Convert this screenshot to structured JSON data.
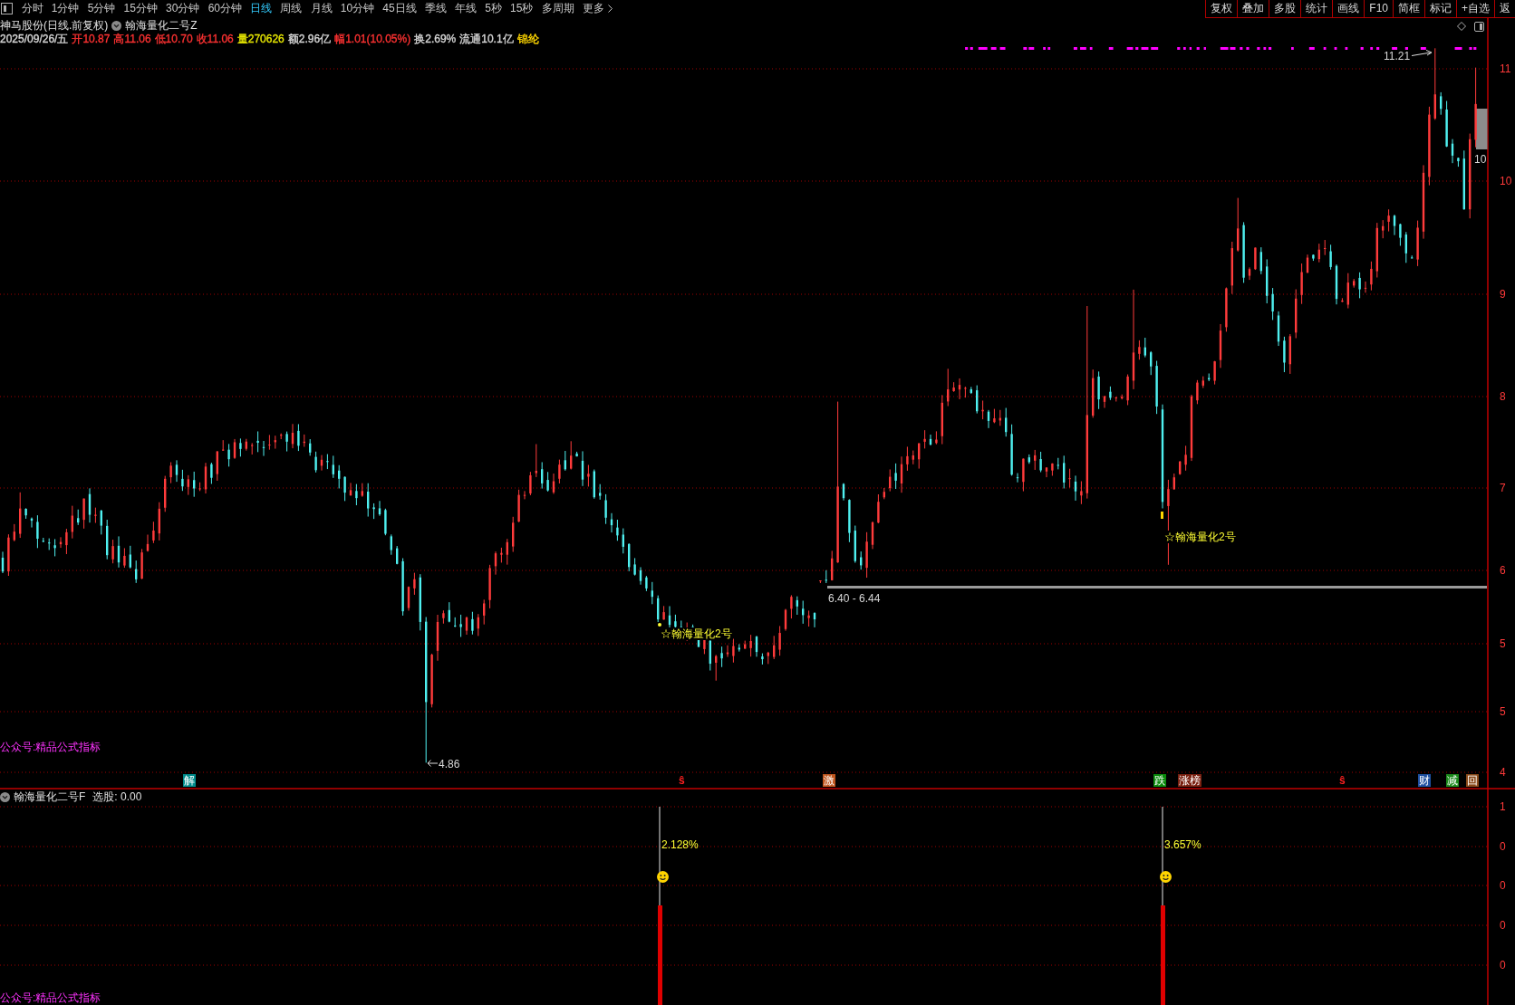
{
  "toolbar": {
    "periods": [
      {
        "label": "分时",
        "selected": false
      },
      {
        "label": "1分钟",
        "selected": false
      },
      {
        "label": "5分钟",
        "selected": false
      },
      {
        "label": "15分钟",
        "selected": false
      },
      {
        "label": "30分钟",
        "selected": false
      },
      {
        "label": "60分钟",
        "selected": false
      },
      {
        "label": "日线",
        "selected": true
      },
      {
        "label": "周线",
        "selected": false
      },
      {
        "label": "月线",
        "selected": false
      },
      {
        "label": "10分钟",
        "selected": false
      },
      {
        "label": "45日线",
        "selected": false
      },
      {
        "label": "季线",
        "selected": false
      },
      {
        "label": "年线",
        "selected": false
      },
      {
        "label": "5秒",
        "selected": false
      },
      {
        "label": "15秒",
        "selected": false
      },
      {
        "label": "多周期",
        "selected": false
      }
    ],
    "more": "更多",
    "buttons": [
      "复权",
      "叠加",
      "多股",
      "统计",
      "画线",
      "F10",
      "简框",
      "标记",
      "+自选",
      "返"
    ]
  },
  "title_row": {
    "security": "神马股份(日线.前复权)",
    "indicator": "翰海量化二号Z"
  },
  "quote_row": [
    {
      "text": "2025/09/26/五",
      "color": "#d8d8d8"
    },
    {
      "text": "开10.87",
      "color": "#ff3232"
    },
    {
      "text": "高11.06",
      "color": "#ff3232"
    },
    {
      "text": "低10.70",
      "color": "#ff3232"
    },
    {
      "text": "收11.06",
      "color": "#ff3232"
    },
    {
      "text": "量270626",
      "color": "#e6e600"
    },
    {
      "text": "额2.96亿",
      "color": "#d8d8d8"
    },
    {
      "text": "幅1.01(10.05%)",
      "color": "#ff3232"
    },
    {
      "text": "换2.69%",
      "color": "#d8d8d8"
    },
    {
      "text": "流通10.1亿",
      "color": "#d8d8d8"
    },
    {
      "text": "锦纶",
      "color": "#ffd700"
    }
  ],
  "main_chart": {
    "price_axis": [
      "11",
      "10",
      "9",
      "8",
      "7",
      "6",
      "5",
      "5",
      "4"
    ],
    "high_label": "11.21",
    "low_label": "4.86",
    "last_price_label": "10",
    "range_label": "6.40 - 6.44",
    "signals": [
      {
        "label": "☆翰海量化2号"
      },
      {
        "label": "☆翰海量化2号"
      }
    ],
    "note": "公众号:精品公式指标",
    "markers": [
      {
        "text": "解",
        "kind": "tag",
        "color": "#008b8b"
      },
      {
        "text": "ŝ",
        "kind": "glyph",
        "color": "#ff2020"
      },
      {
        "text": "激",
        "kind": "tag",
        "color": "#c0561e"
      },
      {
        "text": "跌",
        "kind": "tag",
        "color": "#0a8a0a"
      },
      {
        "text": "涨榜",
        "kind": "tag",
        "color": "#7a2010"
      },
      {
        "text": "ŝ",
        "kind": "glyph",
        "color": "#ff2020"
      },
      {
        "text": "财",
        "kind": "tag",
        "color": "#1f4fa0"
      },
      {
        "text": "减",
        "kind": "tag",
        "color": "#1c8a1c"
      },
      {
        "text": "回",
        "kind": "tag",
        "color": "#8a4a1a"
      }
    ]
  },
  "lower_panel": {
    "title": "翰海量化二号F",
    "reading": "选股: 0.00",
    "axis": [
      "1",
      "0",
      "0",
      "0",
      "0"
    ],
    "signals": [
      {
        "label": "2.128%"
      },
      {
        "label": "3.657%"
      }
    ],
    "note": "公众号:精品公式指标"
  }
}
